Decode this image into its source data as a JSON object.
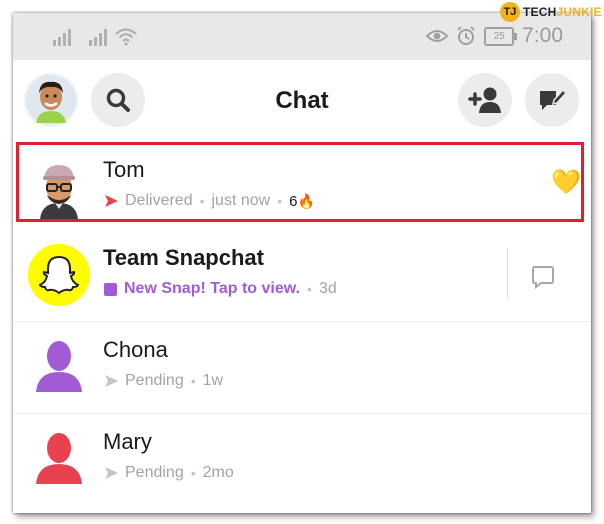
{
  "watermark": {
    "logo_text": "TJ",
    "brand_a": "TECH",
    "brand_b": "JUNKIE"
  },
  "status_bar": {
    "time": "7:00",
    "battery": "25"
  },
  "header": {
    "title": "Chat"
  },
  "chats": [
    {
      "name": "Tom",
      "status": "Delivered",
      "time": "just now",
      "streak": "6",
      "streak_emoji": "🔥",
      "badge_emoji": "💛",
      "status_color": "#e9424f"
    },
    {
      "name": "Team Snapchat",
      "status": "New Snap! Tap to view.",
      "time": "3d",
      "status_color": "#a05bd5"
    },
    {
      "name": "Chona",
      "status": "Pending",
      "time": "1w",
      "avatar_color": "#a05bd5"
    },
    {
      "name": "Mary",
      "status": "Pending",
      "time": "2mo",
      "avatar_color": "#e9424f"
    }
  ]
}
